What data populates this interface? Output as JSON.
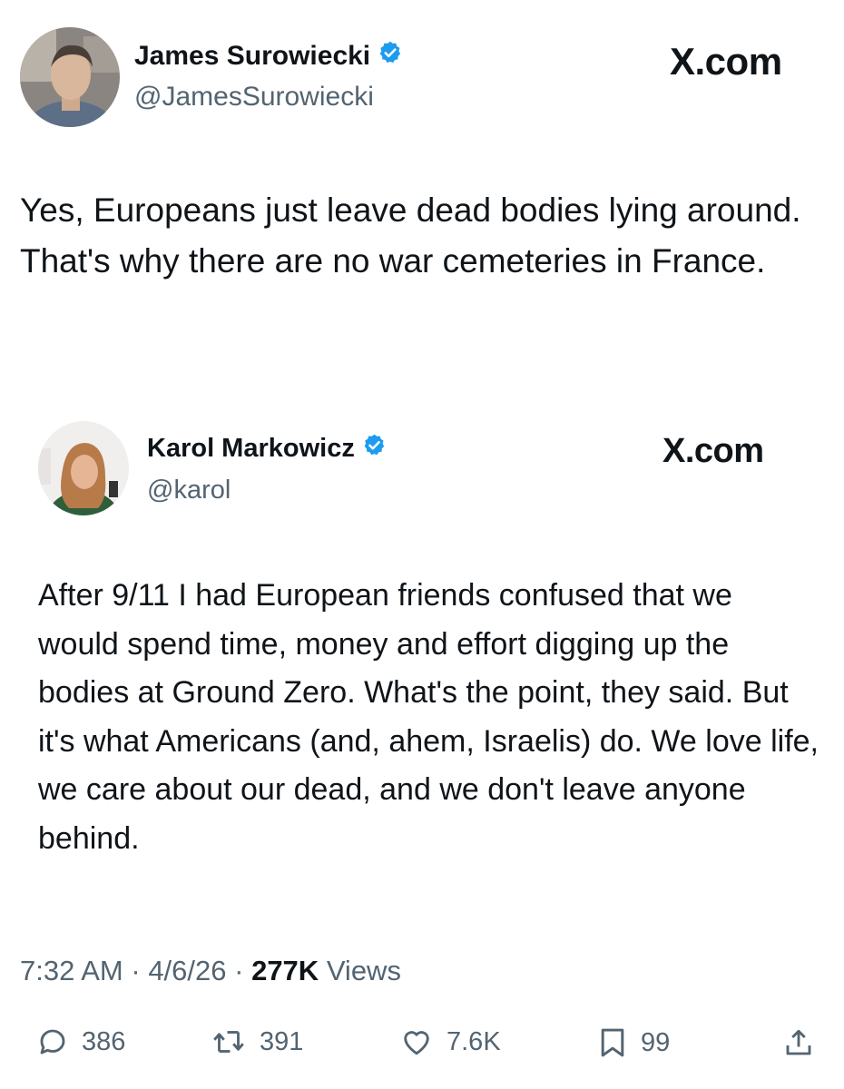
{
  "main_tweet": {
    "author_name": "James Surowiecki",
    "handle": "@JamesSurowiecki",
    "brand": "X.com",
    "text": "Yes, Europeans just leave dead bodies lying around. That's why there are no war cemeteries in France."
  },
  "quoted_tweet": {
    "author_name": "Karol Markowicz",
    "handle": "@karol",
    "brand": "X.com",
    "text": "After 9/11 I had European friends confused that we would spend time, money and effort digging up the bodies at Ground Zero. What's the point, they said. But it's what Americans (and, ahem, Israelis) do. We love life, we care about our dead, and we don't leave anyone behind."
  },
  "meta": {
    "time": "7:32 AM",
    "date": "4/6/26",
    "views_count": "277K",
    "views_label": "Views"
  },
  "actions": {
    "replies": "386",
    "reposts": "391",
    "likes": "7.6K",
    "bookmarks": "99"
  },
  "colors": {
    "verified": "#1d9bf0",
    "text": "#0f1419",
    "secondary": "#536471",
    "background": "#ffffff"
  },
  "icons": [
    "verified-badge-icon",
    "reply-icon",
    "repost-icon",
    "like-icon",
    "bookmark-icon",
    "share-icon"
  ]
}
